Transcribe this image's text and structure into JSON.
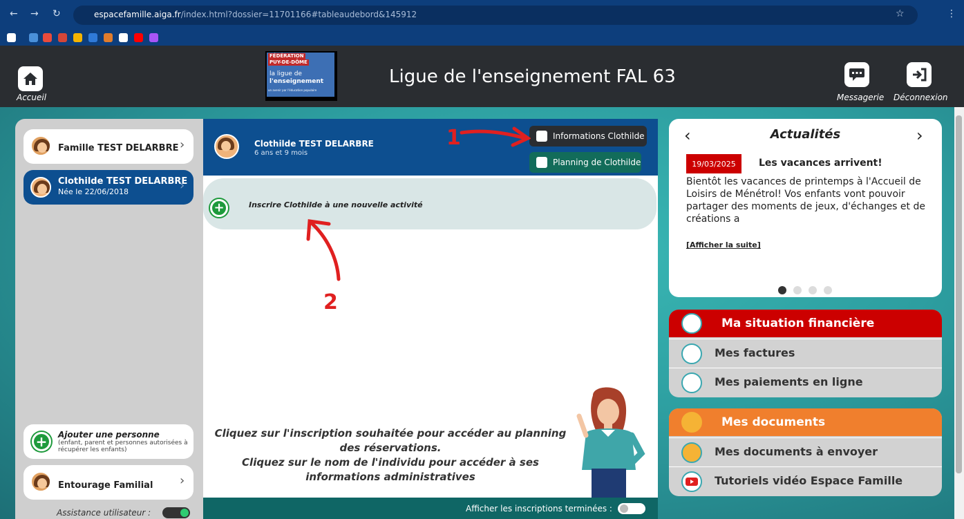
{
  "browser": {
    "url_host": "espacefamille.aiga.fr",
    "url_path": "/index.html?dossier=11701166#tableaudebord&145912"
  },
  "header": {
    "home_label": "Accueil",
    "title": "Ligue de l'enseignement FAL 63",
    "messaging_label": "Messagerie",
    "logout_label": "Déconnexion",
    "logo": {
      "line1": "FÉDÉRATION",
      "line2": "PUY-DE-DÔME",
      "line3": "la ligue de",
      "line4": "l'enseignement",
      "tagline": "un avenir par l'éducation populaire"
    }
  },
  "sidebar": {
    "family_name": "Famille TEST DELARBRE",
    "child_name": "Clothilde TEST DELARBRE",
    "child_birth": "Née le 22/06/2018",
    "add_person_title": "Ajouter une personne",
    "add_person_sub": "(enfant, parent et personnes autorisées à récupérer les enfants)",
    "entourage_label": "Entourage Familial",
    "assistance_label": "Assistance utilisateur :"
  },
  "child_panel": {
    "name": "Clothilde TEST DELARBRE",
    "age": "6 ans et 9 mois",
    "info_button": "Informations Clothilde",
    "planning_button": "Planning de Clothilde",
    "register_label": "Inscrire Clothilde à une nouvelle activité",
    "help_line1": "Cliquez sur l'inscription souhaitée pour accéder au planning des réservations.",
    "help_line2": "Cliquez sur le nom de l'individu pour accéder à ses informations administratives",
    "show_finished_label": "Afficher les inscriptions terminées :"
  },
  "news": {
    "title": "Actualités",
    "date": "19/03/2025",
    "headline": "Les vacances arrivent!",
    "body": "Bientôt les vacances de printemps à l'Accueil de Loisirs de Ménétrol! Vos enfants vont pouvoir partager des moments de jeux, d'échanges et de créations a",
    "more_link": "[Afficher la suite]"
  },
  "finance": {
    "title": "Ma situation financière",
    "items": [
      "Mes factures",
      "Mes paiements en ligne"
    ],
    "color": "#cc0000"
  },
  "documents": {
    "title": "Mes documents",
    "items": [
      "Mes documents à envoyer",
      "Tutoriels vidéo Espace Famille"
    ],
    "color": "#f07f2d"
  },
  "annotations": {
    "one": "1",
    "two": "2"
  },
  "colors": {
    "header_bg": "#2a2d31",
    "child_header": "#0d4f90",
    "teal": "#2d9ea0",
    "accent_red": "#e02020"
  }
}
